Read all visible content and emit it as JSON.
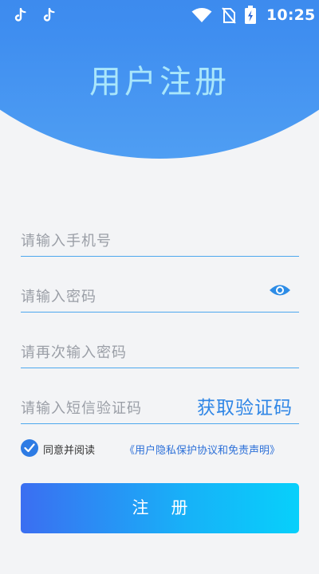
{
  "status_bar": {
    "time": "10:25",
    "icons": [
      "tiktok-icon",
      "tiktok-icon",
      "wifi-icon",
      "no-sim-icon",
      "battery-charging-icon"
    ]
  },
  "page": {
    "title": "用户注册"
  },
  "form": {
    "phone_placeholder": "请输入手机号",
    "password_placeholder": "请输入密码",
    "confirm_password_placeholder": "请再次输入密码",
    "code_placeholder": "请输入短信验证码",
    "get_code_label": "获取验证码",
    "password_visibility_icon": "eye-icon"
  },
  "agreement": {
    "checked": true,
    "text": "同意并阅读",
    "link": "《用户隐私保护协议和免责声明》"
  },
  "actions": {
    "register_label": "注册"
  },
  "colors": {
    "header_gradient_top": "#1f5fd6",
    "header_gradient_bottom": "#4f9ef3",
    "title": "#a9e6fb",
    "field_underline": "#4da8ee",
    "link": "#2d70d8",
    "button_gradient_start": "#3b6ef1",
    "button_gradient_end": "#07d0fb"
  }
}
